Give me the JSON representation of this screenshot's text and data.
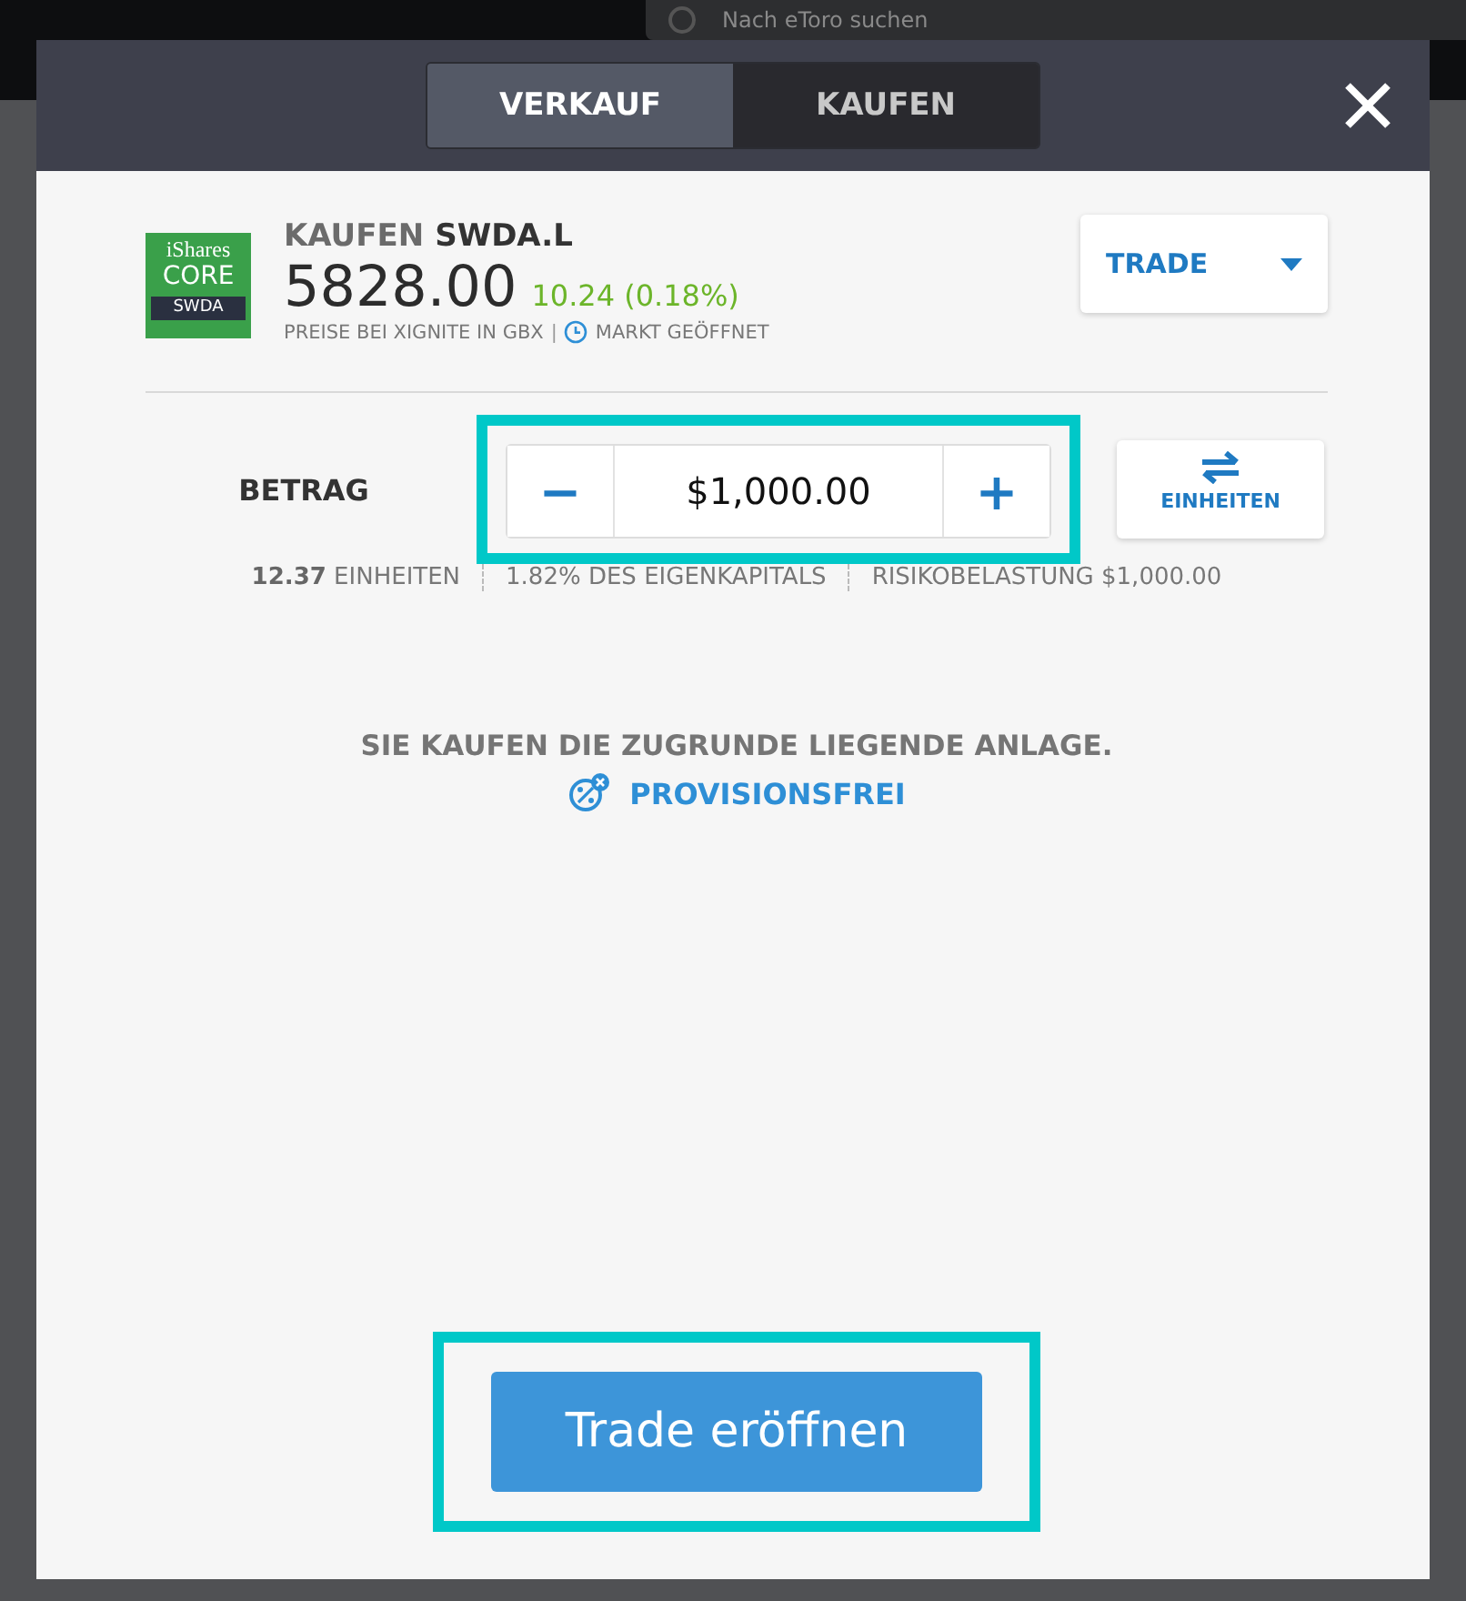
{
  "background": {
    "search": {
      "placeholder": "Nach eToro suchen"
    }
  },
  "tabs": [
    {
      "label": "VERKAUF",
      "selected": true
    },
    {
      "label": "KAUFEN",
      "selected": false
    }
  ],
  "instrument": {
    "logo": {
      "line_1": "iShares",
      "line_2": "CORE",
      "line_3": "SWDA"
    },
    "action": "KAUFEN",
    "symbol": "SWDA.L",
    "price": "5828.00",
    "change": "10.24 (0.18%)",
    "source": "PREISE BEI XIGNITE IN GBX",
    "separator": "|",
    "market_status": "MARKT GEÖFFNET"
  },
  "order_type": {
    "label": "TRADE"
  },
  "amount": {
    "label": "BETRAG",
    "minus": "−",
    "value": "$1,000.00",
    "plus": "+",
    "highlighted": true,
    "toggle": "EINHEITEN"
  },
  "stats": [
    {
      "text": "**12.37** EINHEITEN"
    },
    {
      "text": "1.82% DES EIGENKAPITALS"
    },
    {
      "text": "RISIKOBELASTUNG $1,000.00"
    }
  ],
  "notice": {
    "text": "SIE KAUFEN DIE ZUGRUNDE LIEGENDE ANLAGE.",
    "link": "PROVISIONSFREI"
  },
  "submit": {
    "label": "Trade eröffnen",
    "highlighted": true
  }
}
